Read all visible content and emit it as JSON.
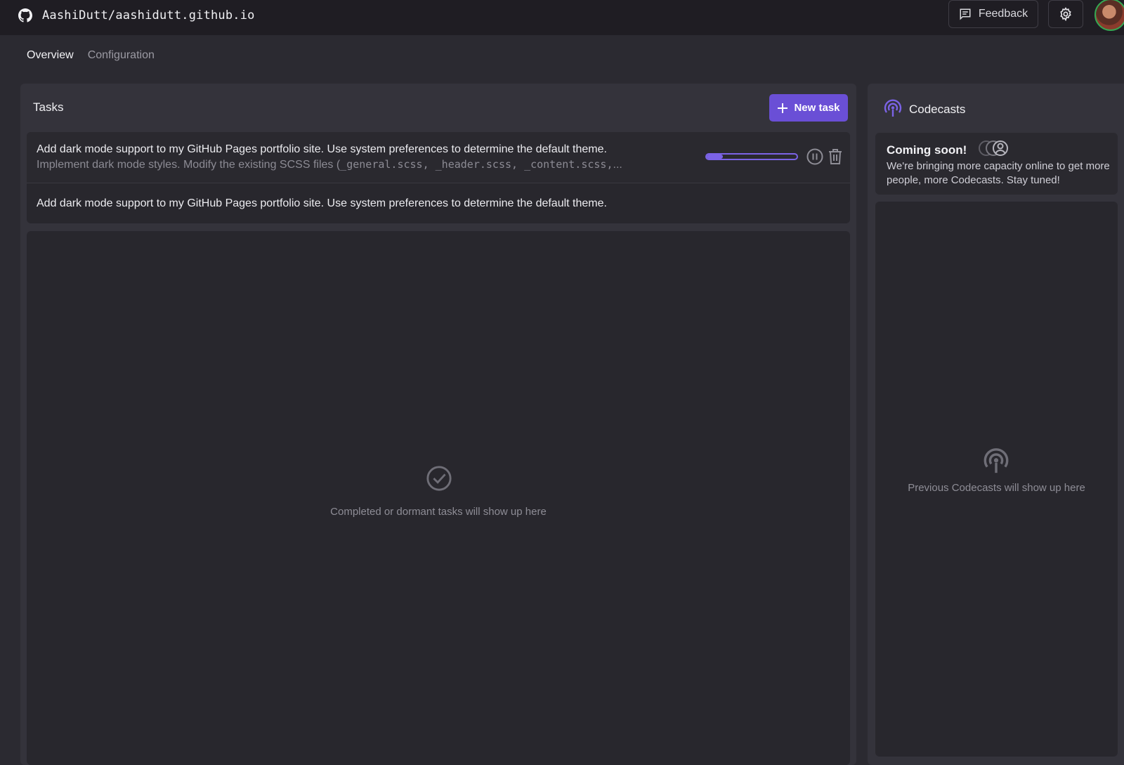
{
  "header": {
    "repo": "AashiDutt/aashidutt.github.io",
    "feedback_label": "Feedback"
  },
  "tabs": [
    {
      "label": "Overview",
      "active": true
    },
    {
      "label": "Configuration",
      "active": false
    }
  ],
  "tasks": {
    "title": "Tasks",
    "new_task_label": "New task",
    "items": [
      {
        "title": "Add dark mode support to my GitHub Pages portfolio site. Use system preferences to determine the default theme.",
        "subtitle_prefix": "Implement dark mode styles. Modify the existing SCSS files (",
        "subtitle_files": "_general.scss, _header.scss, _content.scss,",
        "subtitle_suffix": "...",
        "progress": 0.18
      },
      {
        "title": "Add dark mode support to my GitHub Pages portfolio site. Use system preferences to determine the default theme."
      }
    ],
    "empty_text": "Completed or dormant tasks will show up here"
  },
  "codecasts": {
    "title": "Codecasts",
    "coming_title": "Coming soon!",
    "coming_text": "We're bringing more capacity online to get more people, more Codecasts. Stay tuned!",
    "empty_text": "Previous Codecasts will show up here"
  },
  "colors": {
    "accent": "#6a4fd6",
    "background": "#2b2a31",
    "topbar": "#1f1d23"
  },
  "icons": [
    "github-icon",
    "feedback-icon",
    "gear-icon",
    "plus-icon",
    "pause-icon",
    "trash-icon",
    "check-circle-icon",
    "podcast-icon",
    "people-icon"
  ]
}
